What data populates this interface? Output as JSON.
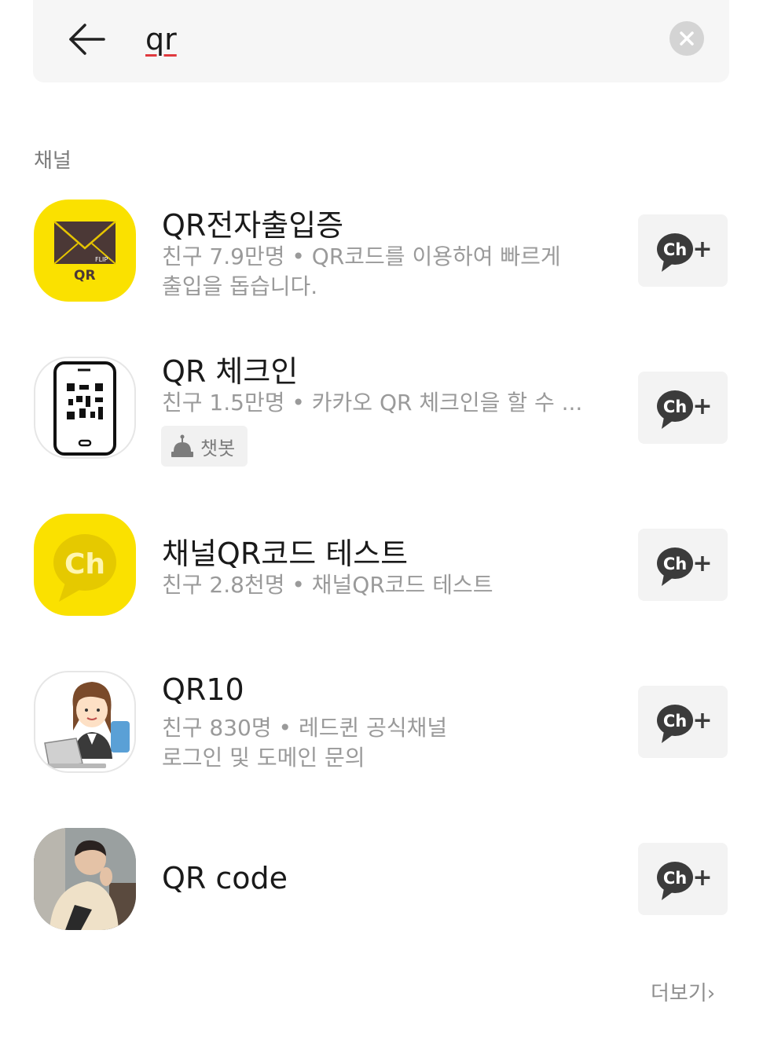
{
  "search": {
    "query": "qr",
    "back_icon": "arrow-left-icon",
    "clear_icon": "close-circle-icon"
  },
  "section": {
    "title": "채널"
  },
  "channels": [
    {
      "name": "QR전자출입증",
      "desc_line1": "친구 7.9만명 • QR코드를 이용하여 빠르게",
      "desc_line2": "출입을 돕습니다.",
      "thumb_label": "QR",
      "thumb_sublabel": "FLIP"
    },
    {
      "name": "QR 체크인",
      "desc_line1": "친구 1.5만명 • 카카오 QR 체크인을 할 수 ...",
      "badge": "챗봇"
    },
    {
      "name": "채널QR코드 테스트",
      "desc_line1": "친구 2.8천명 • 채널QR코드 테스트",
      "thumb_label": "Ch"
    },
    {
      "name": "QR10",
      "desc_line1": "친구 830명 • 레드퀸 공식채널",
      "desc_line2": "로그인 및 도메인 문의"
    },
    {
      "name": "QR code"
    }
  ],
  "add_button": {
    "label": "Ch",
    "plus": "+"
  },
  "more": {
    "label": "더보기",
    "chevron": "›"
  },
  "colors": {
    "yellow": "#fae100",
    "envelope": "#4b3836",
    "ch_bubble": "#3b3b3b",
    "underline": "#e0393e"
  }
}
